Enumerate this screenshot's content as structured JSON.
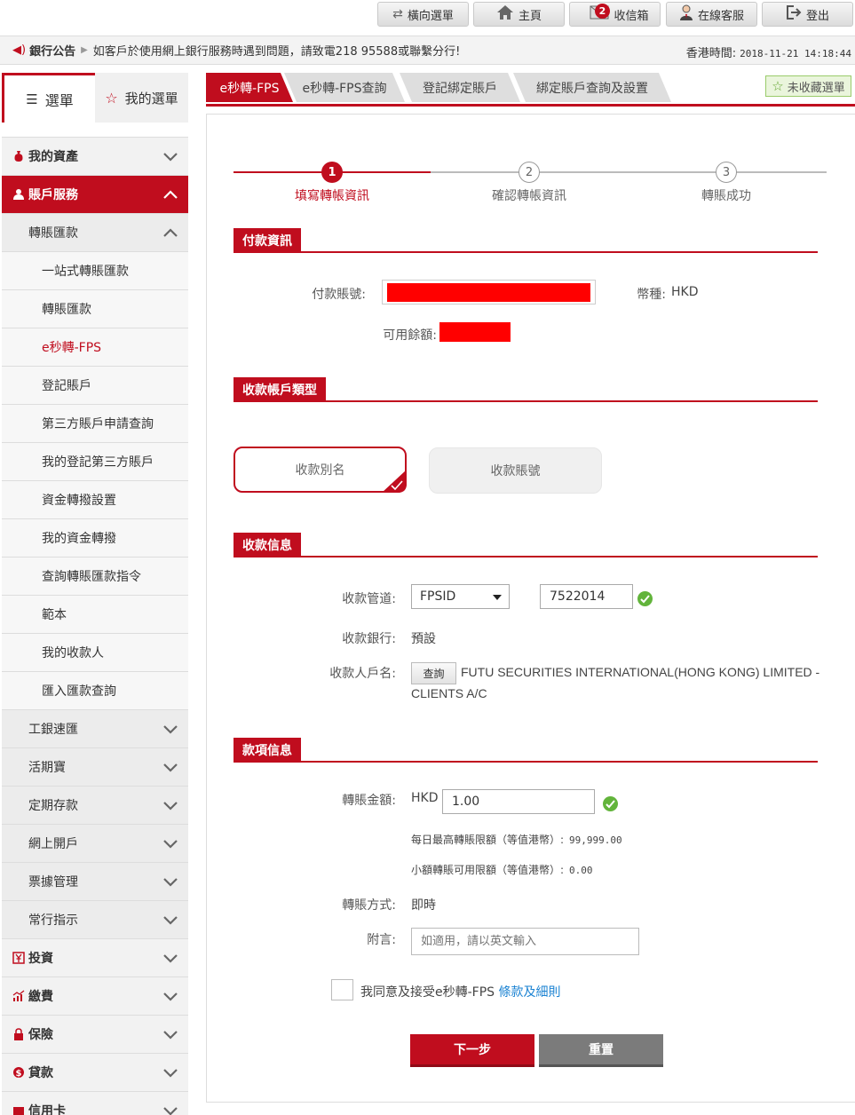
{
  "top_buttons": [
    {
      "label": "橫向選單",
      "icon": "swap-arrows-icon"
    },
    {
      "label": "主頁",
      "icon": "home-icon"
    },
    {
      "label": "收信箱",
      "icon": "mail-icon",
      "badge": "2"
    },
    {
      "label": "在線客服",
      "icon": "support-agent-icon"
    },
    {
      "label": "登出",
      "icon": "logout-icon"
    }
  ],
  "notice": {
    "title": "銀行公告",
    "message": "如客戶於使用網上銀行服務時遇到問題，請致電218 95588或聯繫分行!",
    "time_label": "香港時間:",
    "time_value": "2018-11-21 14:18:44"
  },
  "sidebar": {
    "tab_menu": "選單",
    "tab_favorites": "我的選單",
    "items": [
      {
        "label": "我的資產",
        "level": "top",
        "icon": "money-bag-icon"
      },
      {
        "label": "賬戶服務",
        "level": "top",
        "icon": "user-icon",
        "open": true
      },
      {
        "label": "轉賬匯款",
        "level": "sec",
        "open": true
      },
      {
        "label": "一站式轉賬匯款",
        "level": "leaf"
      },
      {
        "label": "轉賬匯款",
        "level": "leaf"
      },
      {
        "label": "e秒轉-FPS",
        "level": "leaf",
        "current": true
      },
      {
        "label": "登記賬戶",
        "level": "leaf"
      },
      {
        "label": "第三方賬戶申請查詢",
        "level": "leaf"
      },
      {
        "label": "我的登記第三方賬戶",
        "level": "leaf"
      },
      {
        "label": "資金轉撥設置",
        "level": "leaf"
      },
      {
        "label": "我的資金轉撥",
        "level": "leaf"
      },
      {
        "label": "查詢轉賬匯款指令",
        "level": "leaf"
      },
      {
        "label": "範本",
        "level": "leaf"
      },
      {
        "label": "我的收款人",
        "level": "leaf"
      },
      {
        "label": "匯入匯款查詢",
        "level": "leaf"
      },
      {
        "label": "工銀速匯",
        "level": "sec"
      },
      {
        "label": "活期寶",
        "level": "sec"
      },
      {
        "label": "定期存款",
        "level": "sec"
      },
      {
        "label": "網上開戶",
        "level": "sec"
      },
      {
        "label": "票據管理",
        "level": "sec"
      },
      {
        "label": "常行指示",
        "level": "sec"
      },
      {
        "label": "投資",
        "level": "top",
        "icon": "yen-icon"
      },
      {
        "label": "繳費",
        "level": "top",
        "icon": "chart-icon"
      },
      {
        "label": "保險",
        "level": "top",
        "icon": "lock-icon"
      },
      {
        "label": "貸款",
        "level": "top",
        "icon": "dollar-icon"
      },
      {
        "label": "信用卡",
        "level": "top",
        "icon": "card-icon"
      }
    ]
  },
  "tabs": [
    "e秒轉-FPS",
    "e秒轉-FPS查詢",
    "登記綁定賬戶",
    "綁定賬戶查詢及設置"
  ],
  "fav_button": "未收藏選單",
  "steps": [
    {
      "num": "1",
      "label": "填寫轉帳資訊"
    },
    {
      "num": "2",
      "label": "確認轉帳資訊"
    },
    {
      "num": "3",
      "label": "轉賬成功"
    }
  ],
  "payment": {
    "section": "付款資訊",
    "account_label": "付款賬號:",
    "currency_label": "幣種:",
    "currency_value": "HKD",
    "balance_label": "可用餘額:"
  },
  "payee_type": {
    "section": "收款帳戶類型",
    "option_alias": "收款別名",
    "option_account": "收款賬號"
  },
  "payee_info": {
    "section": "收款信息",
    "channel_label": "收款管道:",
    "channel_value": "FPSID",
    "fpsid_value": "7522014",
    "bank_label": "收款銀行:",
    "bank_value": "預設",
    "name_label": "收款人戶名:",
    "query_button": "查詢",
    "name_line1": "FUTU SECURITIES INTERNATIONAL(HONG KONG) LIMITED -",
    "name_line2": "CLIENTS A/C"
  },
  "amount_info": {
    "section": "款項信息",
    "amount_label": "轉賬金額:",
    "amount_currency": "HKD",
    "amount_value": "1.00",
    "daily_limit_label": "每日最高轉賬限額（等值港幣）:",
    "daily_limit_value": "99,999.00",
    "small_limit_label": "小額轉賬可用限額（等值港幣）:",
    "small_limit_value": "0.00",
    "method_label": "轉賬方式:",
    "method_value": "即時",
    "remark_label": "附言:",
    "remark_placeholder": "如適用，請以英文輸入"
  },
  "agree": {
    "text": "我同意及接受e秒轉-FPS",
    "link": "條款及細則"
  },
  "buttons": {
    "next": "下一步",
    "reset": "重置"
  },
  "colors": {
    "brand_red": "#c00d1e",
    "success_green": "#62b43b",
    "link_blue": "#1a82d2"
  }
}
